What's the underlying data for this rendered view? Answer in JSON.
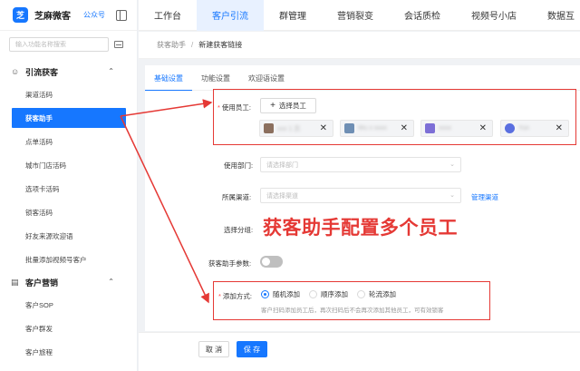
{
  "brand": {
    "logo_char": "芝",
    "name": "芝麻微客",
    "tag": "公众号",
    "accent": "#1677ff"
  },
  "search": {
    "placeholder": "输入功能名称搜索"
  },
  "sidebar": {
    "groups": [
      {
        "label": "引流获客",
        "icon": "user-icon",
        "items": [
          {
            "label": "渠道活码"
          },
          {
            "label": "获客助手",
            "active": true
          },
          {
            "label": "点单活码"
          },
          {
            "label": "城市门店活码"
          },
          {
            "label": "选项卡活码"
          },
          {
            "label": "锁客活码"
          },
          {
            "label": "好友来源欢迎语"
          },
          {
            "label": "批量添加视频号客户"
          }
        ]
      },
      {
        "label": "客户营销",
        "icon": "book-icon",
        "items": [
          {
            "label": "客户SOP"
          },
          {
            "label": "客户群发"
          },
          {
            "label": "客户旅程"
          }
        ]
      }
    ]
  },
  "topnav": {
    "items": [
      "工作台",
      "客户引流",
      "群管理",
      "营销裂变",
      "会话质检",
      "视频号小店",
      "数据互"
    ],
    "active_index": 1
  },
  "breadcrumb": {
    "parent": "获客助手",
    "separator": "/",
    "current": "新建获客链接"
  },
  "tabs": [
    "基础设置",
    "功能设置",
    "欢迎语设置"
  ],
  "form": {
    "staff_label": "使用员工:",
    "select_staff_button": "选择员工",
    "staff_chips": [
      "xxx 1 员",
      "Wu x xxxx",
      "xxxx",
      "Yun"
    ],
    "dept_label": "使用部门:",
    "dept_placeholder": "请选择部门",
    "channel_label": "所属渠道:",
    "channel_placeholder": "请选择渠道",
    "manage_channel_link": "管理渠道",
    "group_label": "选择分组:",
    "param_label": "获客助手参数:",
    "add_method_label": "添加方式:",
    "add_methods": [
      "随机添加",
      "顺序添加",
      "轮流添加"
    ],
    "add_method_selected": "随机添加",
    "add_method_hint": "客户扫码添加员工后，再次扫码后不会再次添加其他员工，可有效锁客"
  },
  "footer": {
    "cancel": "取 消",
    "save": "保 存"
  },
  "annotation": {
    "text": "获客助手配置多个员工",
    "color": "#e53935"
  }
}
